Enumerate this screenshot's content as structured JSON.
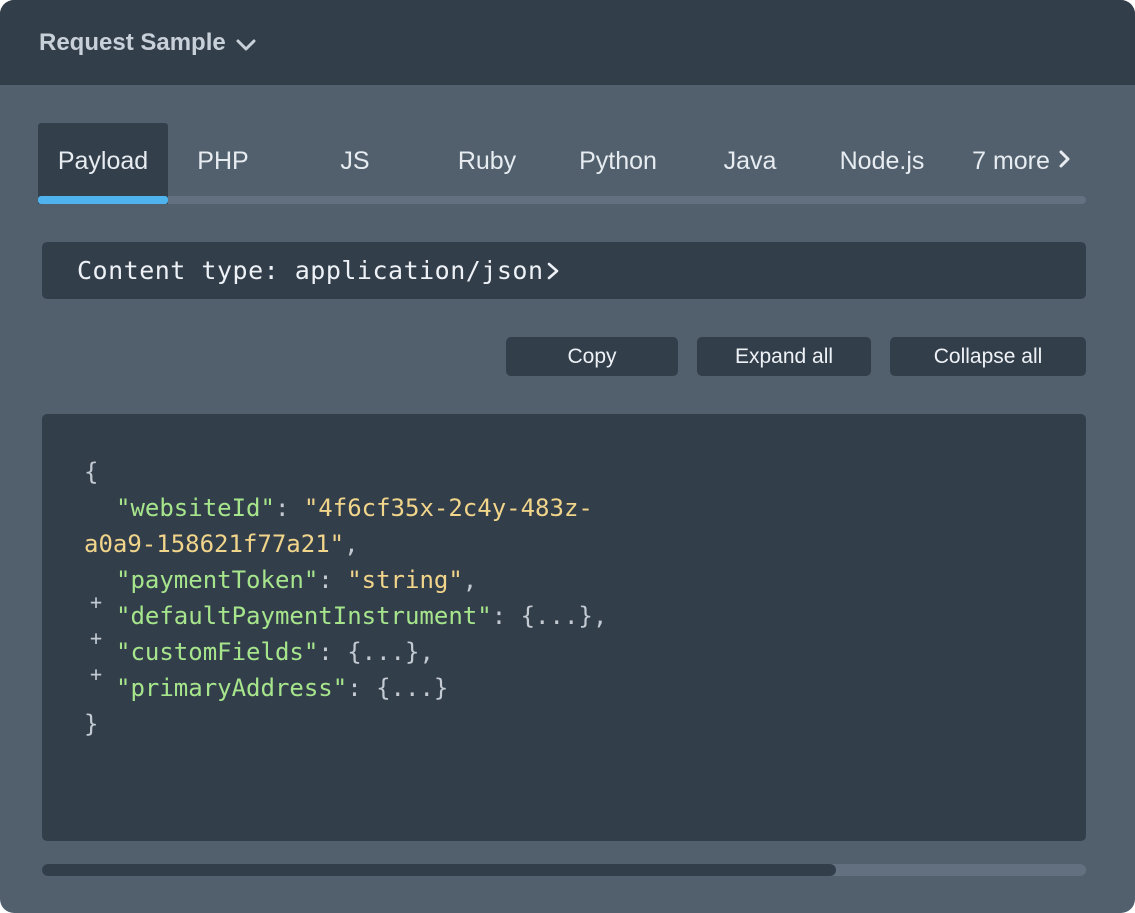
{
  "header": {
    "title": "Request Sample",
    "chevron_icon": "chevron-down-icon"
  },
  "tabs": {
    "items": [
      {
        "label": "Payload",
        "active": true
      },
      {
        "label": "PHP"
      },
      {
        "label": "JS"
      },
      {
        "label": "Ruby"
      },
      {
        "label": "Python"
      },
      {
        "label": "Java"
      },
      {
        "label": "Node.js"
      }
    ],
    "more_label": "7 more",
    "more_icon": "chevron-right-icon"
  },
  "content_type": {
    "label": "Content type: application/json",
    "icon": "chevron-right-icon"
  },
  "toolbar": {
    "copy_label": "Copy",
    "expand_label": "Expand all",
    "collapse_label": "Collapse all"
  },
  "code": {
    "open_brace": "{",
    "close_brace": "}",
    "website_id_key": "\"websiteId\"",
    "website_id_value_part1": "\"4f6cf35x-2c4y-483z-",
    "website_id_value_part2": "a0a9-158621f77a21\"",
    "payment_token_key": "\"paymentToken\"",
    "payment_token_value": "\"string\"",
    "default_payment_key": "\"defaultPaymentInstrument\"",
    "custom_fields_key": "\"customFields\"",
    "primary_address_key": "\"primaryAddress\"",
    "collapsed_object": "{...}",
    "colon": ": ",
    "comma": ",",
    "expand_symbol": "+"
  },
  "colors": {
    "panel_bg": "#52606e",
    "header_bg": "#333e4b",
    "active_tab_underline": "#4fb4ee",
    "json_key": "#a6e58c",
    "json_string": "#f1d58a"
  },
  "scrollbar": {
    "position_fraction": 0.76
  }
}
